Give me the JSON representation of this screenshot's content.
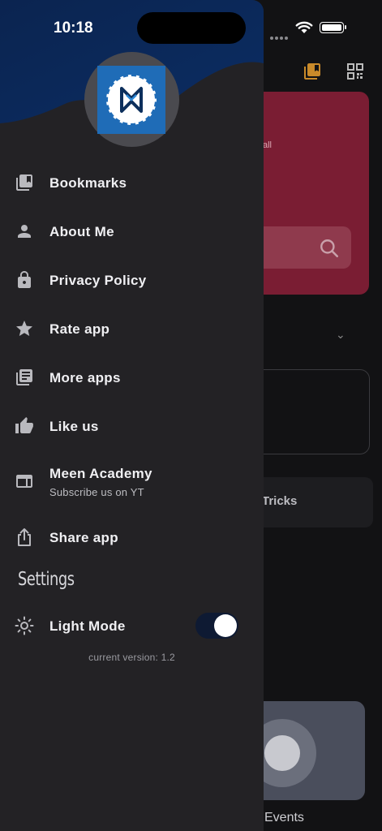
{
  "status_bar": {
    "time": "10:18"
  },
  "background": {
    "card_fragment": "all",
    "tricks_fragment": "Tricks",
    "events_fragment": "Events"
  },
  "drawer": {
    "menu": [
      {
        "label": "Bookmarks",
        "icon": "bookmarks-icon"
      },
      {
        "label": "About Me",
        "icon": "person-icon"
      },
      {
        "label": "Privacy Policy",
        "icon": "lock-icon"
      },
      {
        "label": "Rate app",
        "icon": "star-icon"
      },
      {
        "label": "More apps",
        "icon": "library-books-icon"
      },
      {
        "label": "Like us",
        "icon": "thumb-up-icon"
      },
      {
        "label": "Meen Academy",
        "sublabel": "Subscribe us on YT",
        "icon": "web-window-icon"
      },
      {
        "label": "Share app",
        "icon": "share-icon"
      }
    ],
    "settings": {
      "title": "Settings",
      "light_mode_label": "Light Mode",
      "light_mode_on": true
    },
    "version": "current version: 1.2"
  },
  "colors": {
    "drawer_bg": "#232225",
    "header_wave": "#0b2a5c",
    "card_accent": "#7a1d33",
    "bookmark_accent": "#c98a2a",
    "toggle_track": "#0e1a33"
  }
}
